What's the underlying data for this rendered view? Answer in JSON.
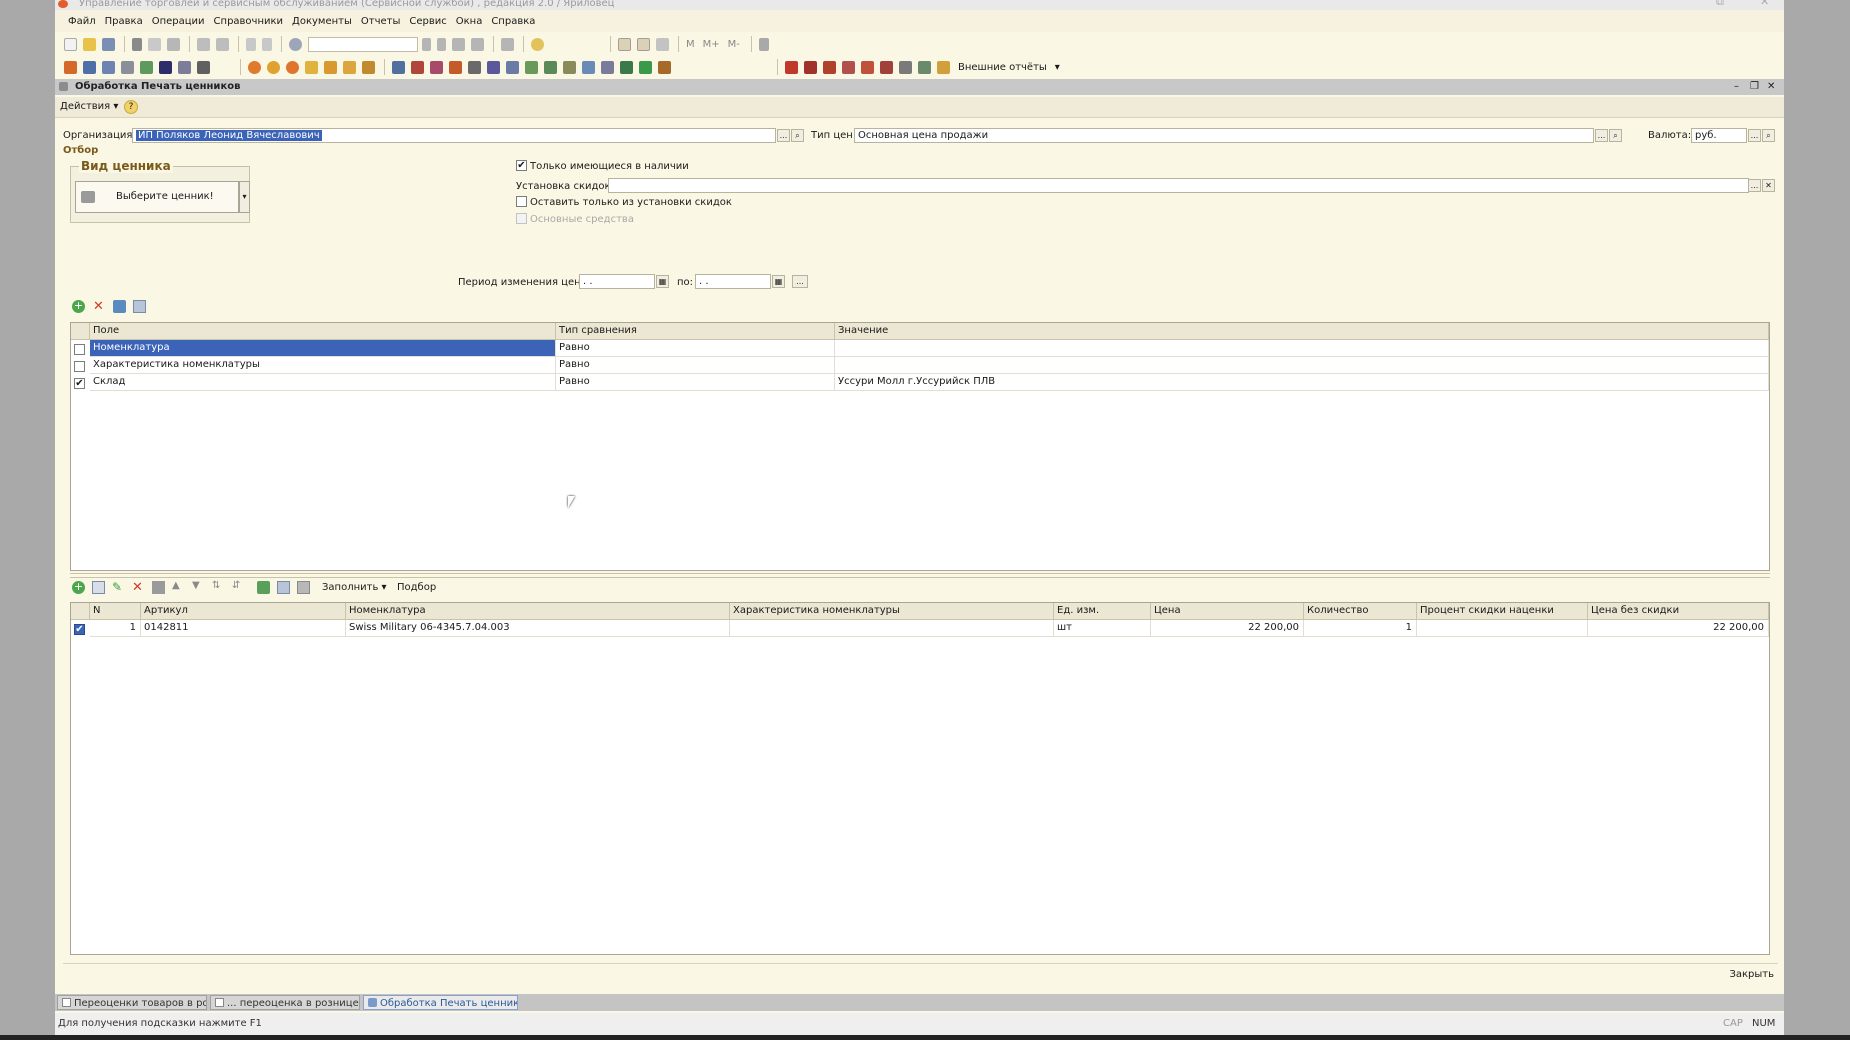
{
  "title": "Управление торговлей и сервисным обслуживанием (Сервисной службой) , редакция 2.0 / Яриловец",
  "menu": [
    "Файл",
    "Правка",
    "Операции",
    "Справочники",
    "Документы",
    "Отчеты",
    "Сервис",
    "Окна",
    "Справка"
  ],
  "toolbar": {
    "mem": [
      "M",
      "M+",
      "M-"
    ],
    "external_reports": "Внешние отчёты"
  },
  "doc_title": "Обработка  Печать ценников",
  "actions": "Действия",
  "org_label": "Организация:",
  "org_value": "ИП Поляков Леонид Вячеславович",
  "price_type_label": "Тип цен:",
  "price_type_value": "Основная цена продажи",
  "currency_label": "Валюта:",
  "currency_value": "руб.",
  "filter_label": "Отбор",
  "tag_group": "Вид ценника",
  "tag_button": "Выберите ценник!",
  "only_in_stock": "Только имеющиеся в наличии",
  "discount_label": "Установка скидок:",
  "only_from_discount": "Оставить только из установки скидок",
  "fixed_assets": "Основные средства",
  "period_label": "Период изменения цен с:",
  "period_from": ". .",
  "period_to_label": "по:",
  "period_to": ". .",
  "filter_table": {
    "columns": [
      "Поле",
      "Тип сравнения",
      "Значение"
    ],
    "rows": [
      {
        "checked": false,
        "field": "Номенклатура",
        "cmp": "Равно",
        "value": ""
      },
      {
        "checked": false,
        "field": "Характеристика номенклатуры",
        "cmp": "Равно",
        "value": ""
      },
      {
        "checked": true,
        "field": "Склад",
        "cmp": "Равно",
        "value": "Уссури Молл  г.Уссурийск ПЛВ"
      }
    ]
  },
  "bottom_toolbar": {
    "fill": "Заполнить",
    "pick": "Подбор"
  },
  "items_table": {
    "columns": [
      "N",
      "Артикул",
      "Номенклатура",
      "Характеристика номенклатуры",
      "Ед. изм.",
      "Цена",
      "Количество",
      "Процент скидки наценки",
      "Цена без скидки"
    ],
    "rows": [
      {
        "n": "1",
        "article": "0142811",
        "name": "Swiss Military  06-4345.7.04.003",
        "char": "",
        "unit": "шт",
        "price": "22 200,00",
        "qty": "1",
        "pct": "",
        "price_nodisc": "22 200,00"
      }
    ]
  },
  "close": "Закрыть",
  "tasks": [
    "Переоценки товаров в роз...",
    "... переоценка в рознице...",
    "Обработка  Печать ценников"
  ],
  "status_hint": "Для получения подсказки нажмите F1",
  "indicators": [
    "CAP",
    "NUM"
  ]
}
